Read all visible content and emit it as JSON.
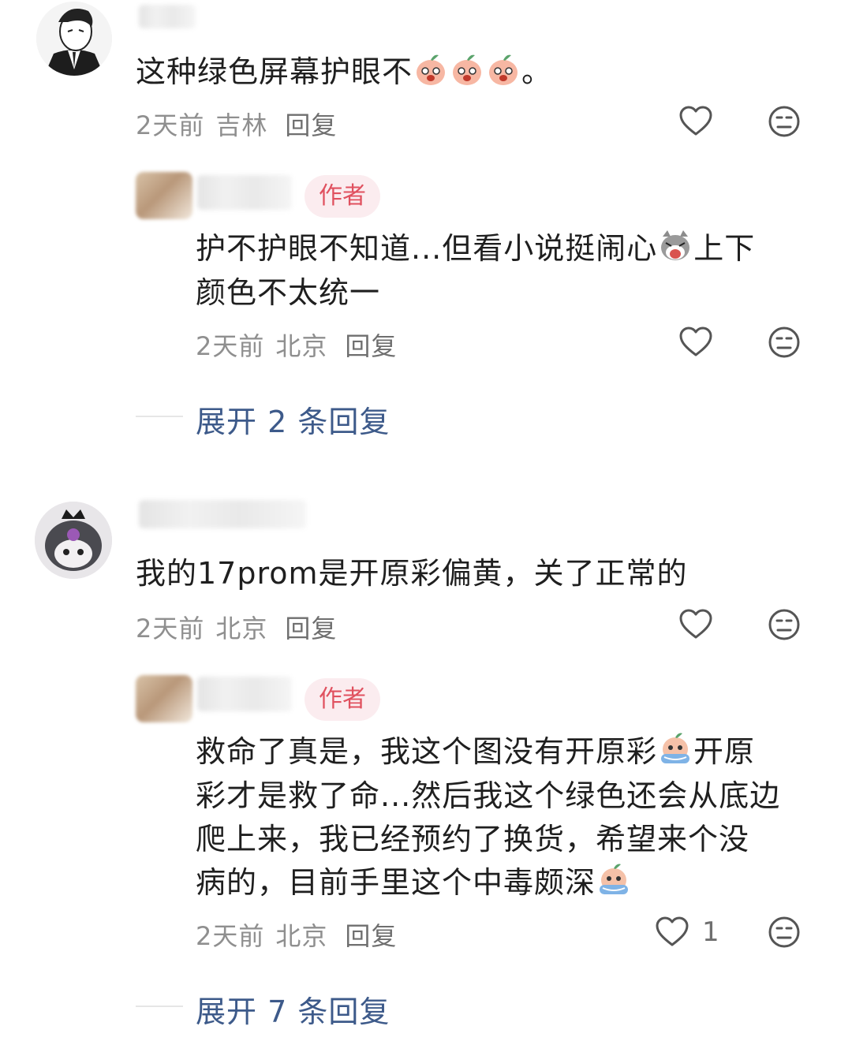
{
  "comments": [
    {
      "text": "这种绿色屏幕护眼不",
      "text_end": "。",
      "emoji": "peach-emoji",
      "time": "2天前",
      "location": "吉林",
      "reply_label": "回复",
      "reply": {
        "badge": "作者",
        "line1": "护不护眼不知道...但看小说挺闹心",
        "line1_end": "上下",
        "line2": "颜色不太统一",
        "emoji": "cat-emoji",
        "time": "2天前",
        "location": "北京",
        "reply_label": "回复"
      },
      "expand_label": "展开 2 条回复"
    },
    {
      "text": "我的17prom是开原彩偏黄，关了正常的",
      "time": "2天前",
      "location": "北京",
      "reply_label": "回复",
      "reply": {
        "badge": "作者",
        "line1": "救命了真是，我这个图没有开原彩",
        "line1_end": "开原",
        "line2": "彩才是救了命...然后我这个绿色还会从底边",
        "line3": "爬上来，我已经预约了换货，希望来个没",
        "line4": "病的，目前手里这个中毒颇深",
        "emoji": "peach-cry-emoji",
        "time": "2天前",
        "location": "北京",
        "reply_label": "回复",
        "like_count": "1"
      },
      "expand_label": "展开 7 条回复"
    }
  ],
  "icons": {
    "like": "heart-outline-icon",
    "dislike": "meh-face-icon"
  },
  "colors": {
    "badge_bg": "#fbecef",
    "badge_text": "#e0515f",
    "link": "#3d5a8a",
    "meta": "#8f8f8f"
  }
}
